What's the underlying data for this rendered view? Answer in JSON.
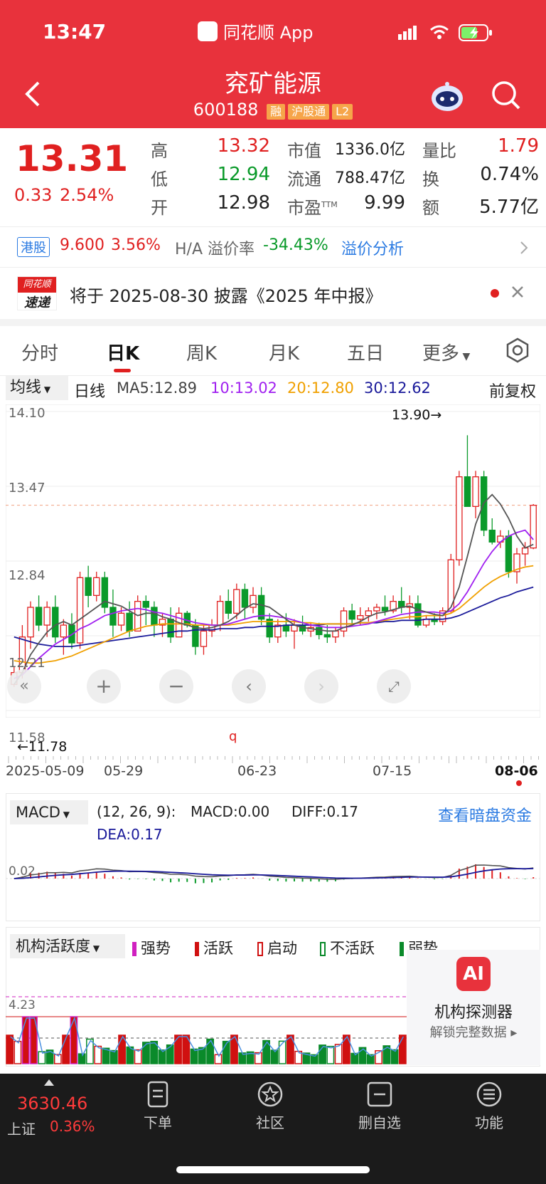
{
  "status_bar": {
    "time": "13:47",
    "app_name": "同花顺 App"
  },
  "header": {
    "title": "兖矿能源",
    "code": "600188",
    "chips": [
      "融",
      "沪股通",
      "L2"
    ]
  },
  "quote": {
    "price": "13.31",
    "change": "0.33",
    "change_pct": "2.54%",
    "fields": [
      {
        "label": "高",
        "value": "13.32",
        "color": "red"
      },
      {
        "label": "低",
        "value": "12.94",
        "color": "green"
      },
      {
        "label": "开",
        "value": "12.98",
        "color": "dark"
      },
      {
        "label": "市值",
        "value": "1336.0亿"
      },
      {
        "label": "流通",
        "value": "788.47亿"
      },
      {
        "label": "市盈",
        "sup": "TTM",
        "value": "9.99"
      },
      {
        "label": "量比",
        "value": "1.79",
        "color": "red"
      },
      {
        "label": "换",
        "value": "0.74%"
      },
      {
        "label": "额",
        "value": "5.77亿"
      }
    ]
  },
  "hk": {
    "tag": "港股",
    "price": "9.600",
    "pct": "3.56%",
    "premium_label": "H/A 溢价率",
    "premium_value": "-34.43%",
    "link": "溢价分析"
  },
  "news": {
    "logo_top": "同花顺",
    "logo_bottom": "速递",
    "text": "将于 2025-08-30 披露《2025 年中报》"
  },
  "tabs": [
    "分时",
    "日K",
    "周K",
    "月K",
    "五日",
    "更多"
  ],
  "active_tab": 1,
  "ma_bar": {
    "selector": "均线",
    "type": "日线",
    "ma5": "MA5:12.89",
    "ma10": "10:13.02",
    "ma20": "20:12.80",
    "ma30": "30:12.62",
    "adjust": "前复权"
  },
  "price_axis": [
    "14.10",
    "13.47",
    "12.84",
    "12.21",
    "11.58"
  ],
  "markers": {
    "high": "13.90→",
    "low": "←11.78"
  },
  "dates": [
    "2025-05-09",
    "05-29",
    "06-23",
    "07-15",
    "08-06"
  ],
  "macd": {
    "selector": "MACD",
    "params": "(12, 26, 9):",
    "macd": "MACD:0.00",
    "diff": "DIFF:0.17",
    "dea": "DEA:0.17",
    "link": "查看暗盘资金",
    "axis": "0.02"
  },
  "inst": {
    "selector": "机构活跃度",
    "legend": [
      "强势",
      "活跃",
      "启动",
      "不活跃",
      "弱势"
    ],
    "axis": "4.23",
    "ai_title": "机构探测器",
    "ai_sub": "解锁完整数据 ▸"
  },
  "bottom": {
    "index_value": "3630.46",
    "index_name": "上证",
    "index_pct": "0.36%",
    "nav": [
      "下单",
      "社区",
      "删自选",
      "功能"
    ]
  },
  "colors": {
    "brand_red": "#e8323c",
    "up": "#e02020",
    "down": "#0a9a2a",
    "ma5": "#555555",
    "ma10": "#a020f0",
    "ma20": "#f0a000",
    "ma30": "#1a1a9a"
  },
  "chart_data": {
    "type": "candlestick",
    "ylim": [
      11.58,
      14.1
    ],
    "candles": [
      [
        11.8,
        11.95,
        11.78,
        11.9
      ],
      [
        11.9,
        12.3,
        11.85,
        12.2
      ],
      [
        12.2,
        12.5,
        12.1,
        12.45
      ],
      [
        12.45,
        12.55,
        12.25,
        12.3
      ],
      [
        12.3,
        12.5,
        12.2,
        12.45
      ],
      [
        12.45,
        12.55,
        12.15,
        12.2
      ],
      [
        12.2,
        12.35,
        12.05,
        12.3
      ],
      [
        12.3,
        12.4,
        12.1,
        12.15
      ],
      [
        12.15,
        12.75,
        12.1,
        12.7
      ],
      [
        12.7,
        12.8,
        12.45,
        12.55
      ],
      [
        12.55,
        12.75,
        12.5,
        12.7
      ],
      [
        12.7,
        12.75,
        12.4,
        12.45
      ],
      [
        12.45,
        12.6,
        12.2,
        12.3
      ],
      [
        12.3,
        12.45,
        12.25,
        12.4
      ],
      [
        12.4,
        12.5,
        12.2,
        12.25
      ],
      [
        12.25,
        12.55,
        12.25,
        12.5
      ],
      [
        12.5,
        12.55,
        12.3,
        12.45
      ],
      [
        12.45,
        12.5,
        12.2,
        12.3
      ],
      [
        12.3,
        12.4,
        12.2,
        12.35
      ],
      [
        12.35,
        12.45,
        12.15,
        12.2
      ],
      [
        12.2,
        12.45,
        12.2,
        12.4
      ],
      [
        12.4,
        12.42,
        12.28,
        12.3
      ],
      [
        12.3,
        12.35,
        12.05,
        12.12
      ],
      [
        12.12,
        12.3,
        12.05,
        12.25
      ],
      [
        12.25,
        12.35,
        12.2,
        12.3
      ],
      [
        12.3,
        12.55,
        12.25,
        12.5
      ],
      [
        12.5,
        12.6,
        12.35,
        12.4
      ],
      [
        12.4,
        12.65,
        12.35,
        12.6
      ],
      [
        12.6,
        12.65,
        12.35,
        12.45
      ],
      [
        12.45,
        12.62,
        12.4,
        12.55
      ],
      [
        12.55,
        12.62,
        12.3,
        12.35
      ],
      [
        12.35,
        12.4,
        12.15,
        12.2
      ],
      [
        12.2,
        12.35,
        12.15,
        12.3
      ],
      [
        12.3,
        12.4,
        12.2,
        12.25
      ],
      [
        12.25,
        12.35,
        12.1,
        12.3
      ],
      [
        12.3,
        12.38,
        12.22,
        12.25
      ],
      [
        12.25,
        12.32,
        12.2,
        12.28
      ],
      [
        12.28,
        12.32,
        12.18,
        12.22
      ],
      [
        12.22,
        12.3,
        12.15,
        12.2
      ],
      [
        12.2,
        12.28,
        12.15,
        12.25
      ],
      [
        12.25,
        12.45,
        12.2,
        12.42
      ],
      [
        12.42,
        12.48,
        12.3,
        12.35
      ],
      [
        12.35,
        12.45,
        12.3,
        12.38
      ],
      [
        12.38,
        12.45,
        12.33,
        12.42
      ],
      [
        12.42,
        12.48,
        12.35,
        12.45
      ],
      [
        12.45,
        12.55,
        12.38,
        12.42
      ],
      [
        12.42,
        12.55,
        12.4,
        12.5
      ],
      [
        12.5,
        12.62,
        12.4,
        12.45
      ],
      [
        12.45,
        12.55,
        12.35,
        12.48
      ],
      [
        12.48,
        12.55,
        12.28,
        12.3
      ],
      [
        12.3,
        12.38,
        12.28,
        12.35
      ],
      [
        12.35,
        12.4,
        12.3,
        12.33
      ],
      [
        12.33,
        12.45,
        12.3,
        12.42
      ],
      [
        12.42,
        12.9,
        12.4,
        12.85
      ],
      [
        12.85,
        13.6,
        12.8,
        13.55
      ],
      [
        13.55,
        13.9,
        13.4,
        13.3
      ],
      [
        13.3,
        13.6,
        13.2,
        13.55
      ],
      [
        13.55,
        13.6,
        13.05,
        13.1
      ],
      [
        13.1,
        13.2,
        12.98,
        13.0
      ],
      [
        13.0,
        13.1,
        12.95,
        13.05
      ],
      [
        13.05,
        13.1,
        12.7,
        12.75
      ],
      [
        12.75,
        12.95,
        12.65,
        12.9
      ],
      [
        12.9,
        13.0,
        12.8,
        12.95
      ],
      [
        12.95,
        13.32,
        12.94,
        13.31
      ]
    ],
    "ma5": [
      11.8,
      11.9,
      12.05,
      12.15,
      12.24,
      12.3,
      12.33,
      12.3,
      12.35,
      12.4,
      12.45,
      12.5,
      12.48,
      12.46,
      12.42,
      12.38,
      12.4,
      12.4,
      12.37,
      12.35,
      12.32,
      12.3,
      12.28,
      12.27,
      12.28,
      12.3,
      12.33,
      12.38,
      12.44,
      12.48,
      12.47,
      12.45,
      12.4,
      12.35,
      12.3,
      12.28,
      12.27,
      12.26,
      12.25,
      12.25,
      12.28,
      12.3,
      12.33,
      12.37,
      12.4,
      12.41,
      12.43,
      12.45,
      12.46,
      12.43,
      12.41,
      12.39,
      12.38,
      12.45,
      12.62,
      12.88,
      13.15,
      13.33,
      13.4,
      13.32,
      13.2,
      13.05,
      12.95,
      12.98
    ],
    "ma10": [
      11.85,
      11.88,
      11.95,
      12.02,
      12.08,
      12.14,
      12.18,
      12.22,
      12.27,
      12.3,
      12.34,
      12.38,
      12.4,
      12.42,
      12.43,
      12.44,
      12.43,
      12.41,
      12.4,
      12.38,
      12.36,
      12.34,
      12.32,
      12.31,
      12.3,
      12.3,
      12.31,
      12.33,
      12.35,
      12.37,
      12.38,
      12.38,
      12.37,
      12.36,
      12.34,
      12.32,
      12.3,
      12.29,
      12.28,
      12.28,
      12.28,
      12.29,
      12.3,
      12.31,
      12.33,
      12.35,
      12.37,
      12.39,
      12.4,
      12.41,
      12.41,
      12.41,
      12.4,
      12.42,
      12.48,
      12.58,
      12.7,
      12.82,
      12.92,
      13.0,
      13.05,
      13.08,
      13.1,
      13.02
    ],
    "ma20": [
      12.0,
      11.99,
      11.98,
      11.98,
      11.99,
      12.0,
      12.02,
      12.04,
      12.07,
      12.1,
      12.13,
      12.16,
      12.19,
      12.22,
      12.25,
      12.27,
      12.29,
      12.3,
      12.31,
      12.31,
      12.31,
      12.31,
      12.3,
      12.3,
      12.3,
      12.3,
      12.3,
      12.31,
      12.32,
      12.33,
      12.33,
      12.33,
      12.33,
      12.33,
      12.33,
      12.32,
      12.32,
      12.31,
      12.31,
      12.31,
      12.31,
      12.31,
      12.32,
      12.32,
      12.33,
      12.34,
      12.35,
      12.36,
      12.37,
      12.37,
      12.38,
      12.38,
      12.38,
      12.4,
      12.44,
      12.5,
      12.56,
      12.62,
      12.67,
      12.71,
      12.74,
      12.77,
      12.79,
      12.8
    ],
    "ma30": [
      12.2,
      12.18,
      12.16,
      12.14,
      12.13,
      12.12,
      12.12,
      12.12,
      12.13,
      12.14,
      12.15,
      12.16,
      12.17,
      12.18,
      12.19,
      12.2,
      12.21,
      12.22,
      12.23,
      12.24,
      12.25,
      12.25,
      12.26,
      12.26,
      12.26,
      12.27,
      12.27,
      12.27,
      12.28,
      12.28,
      12.29,
      12.29,
      12.29,
      12.3,
      12.3,
      12.3,
      12.3,
      12.3,
      12.31,
      12.31,
      12.31,
      12.31,
      12.32,
      12.32,
      12.32,
      12.33,
      12.33,
      12.34,
      12.34,
      12.34,
      12.35,
      12.35,
      12.35,
      12.36,
      12.38,
      12.41,
      12.44,
      12.47,
      12.5,
      12.53,
      12.55,
      12.58,
      12.6,
      12.62
    ]
  }
}
